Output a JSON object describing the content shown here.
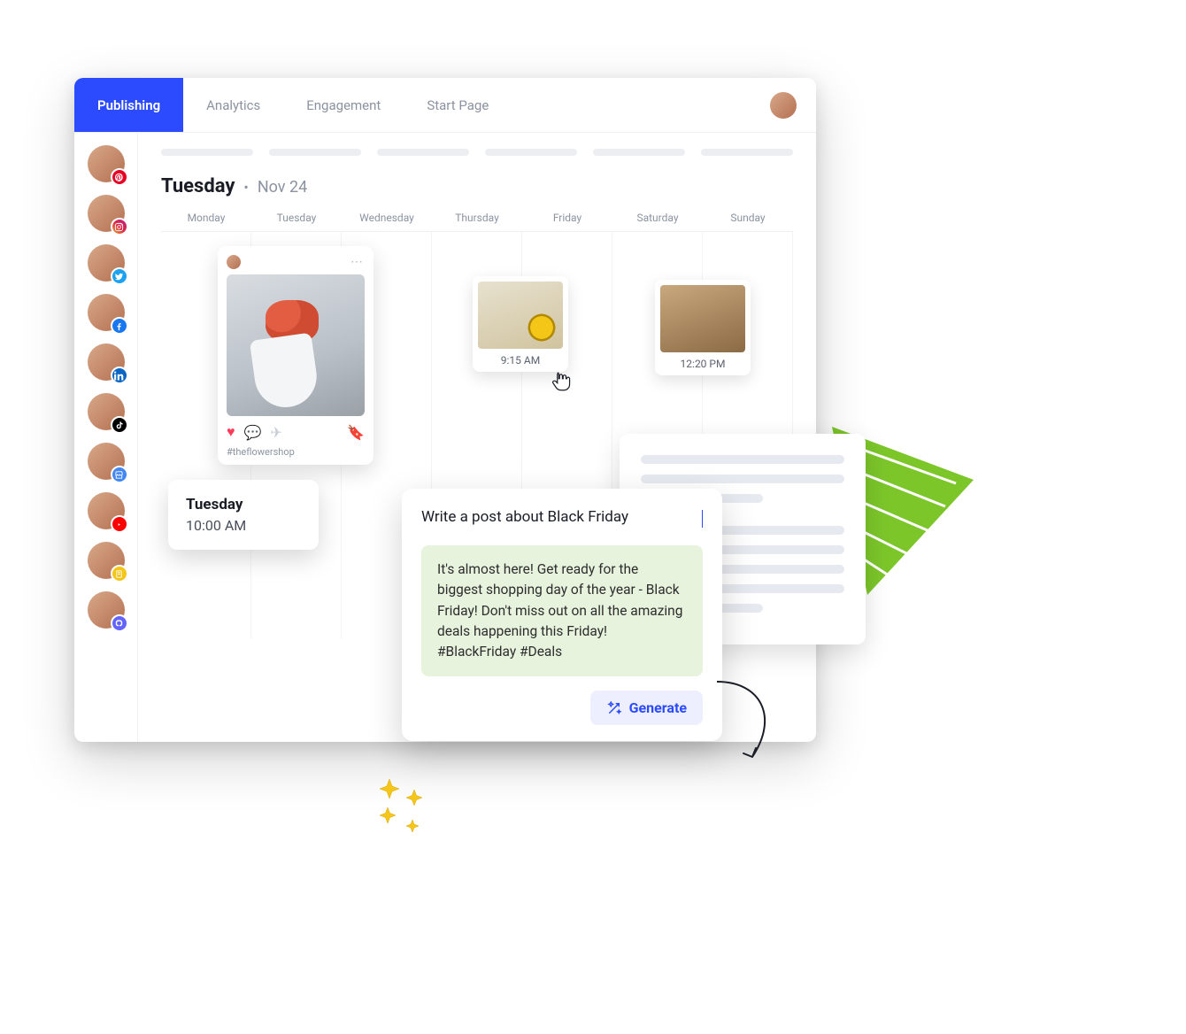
{
  "nav": {
    "tabs": [
      "Publishing",
      "Analytics",
      "Engagement",
      "Start Page"
    ],
    "active_index": 0
  },
  "sidebar": {
    "channels": [
      {
        "network": "pinterest"
      },
      {
        "network": "instagram"
      },
      {
        "network": "twitter"
      },
      {
        "network": "facebook"
      },
      {
        "network": "linkedin"
      },
      {
        "network": "tiktok"
      },
      {
        "network": "google"
      },
      {
        "network": "youtube"
      },
      {
        "network": "shop"
      },
      {
        "network": "mastodon"
      }
    ]
  },
  "calendar": {
    "selected_day": "Tuesday",
    "selected_date": "Nov 24",
    "weekdays": [
      "Monday",
      "Tuesday",
      "Wednesday",
      "Thursday",
      "Friday",
      "Saturday",
      "Sunday"
    ],
    "thumbs": {
      "thursday_time": "9:15 AM",
      "saturday_time": "12:20 PM"
    }
  },
  "post_preview": {
    "caption": "#theflowershop"
  },
  "time_popover": {
    "day": "Tuesday",
    "time": "10:00 AM"
  },
  "compose": {
    "input_text": "Write a post about Black Friday",
    "generated_text": "It's almost here! Get ready for the biggest shopping day of the year - Black Friday! Don't miss out on all the amazing deals happening this Friday! #BlackFriday #Deals",
    "button_label": "Generate"
  }
}
